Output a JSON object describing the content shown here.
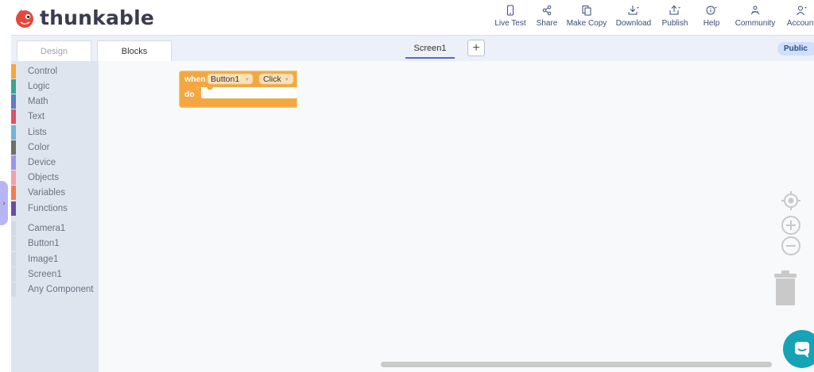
{
  "app": {
    "logo_text": "thunkable",
    "brand_color": "#e8463c"
  },
  "nav": [
    {
      "label": "Live Test",
      "icon": "phone-icon"
    },
    {
      "label": "Share",
      "icon": "share-icon"
    },
    {
      "label": "Make Copy",
      "icon": "copy-icon"
    },
    {
      "label": "Download",
      "icon": "download-icon"
    },
    {
      "label": "Publish",
      "icon": "publish-icon"
    },
    {
      "label": "Help",
      "icon": "help-icon"
    },
    {
      "label": "Community",
      "icon": "community-icon"
    },
    {
      "label": "Account",
      "icon": "account-icon"
    }
  ],
  "tabs": {
    "design": "Design",
    "blocks": "Blocks",
    "screen": "Screen1",
    "add": "+",
    "visibility": "Public"
  },
  "categories": [
    {
      "label": "Control",
      "color": "#f4a641"
    },
    {
      "label": "Logic",
      "color": "#3aa58e"
    },
    {
      "label": "Math",
      "color": "#5b7ec2"
    },
    {
      "label": "Text",
      "color": "#d9536a"
    },
    {
      "label": "Lists",
      "color": "#73b3d6"
    },
    {
      "label": "Color",
      "color": "#6e6e6e"
    },
    {
      "label": "Device",
      "color": "#9a95e8"
    },
    {
      "label": "Objects",
      "color": "#f2a0ad"
    },
    {
      "label": "Variables",
      "color": "#f27d54"
    },
    {
      "label": "Functions",
      "color": "#6a4fa0"
    }
  ],
  "components": [
    {
      "label": "Camera1"
    },
    {
      "label": "Button1"
    },
    {
      "label": "Image1"
    },
    {
      "label": "Screen1"
    },
    {
      "label": "Any Component"
    }
  ],
  "block": {
    "when": "when",
    "component": "Button1",
    "event": "Click",
    "do": "do",
    "color": "#f4a641"
  }
}
